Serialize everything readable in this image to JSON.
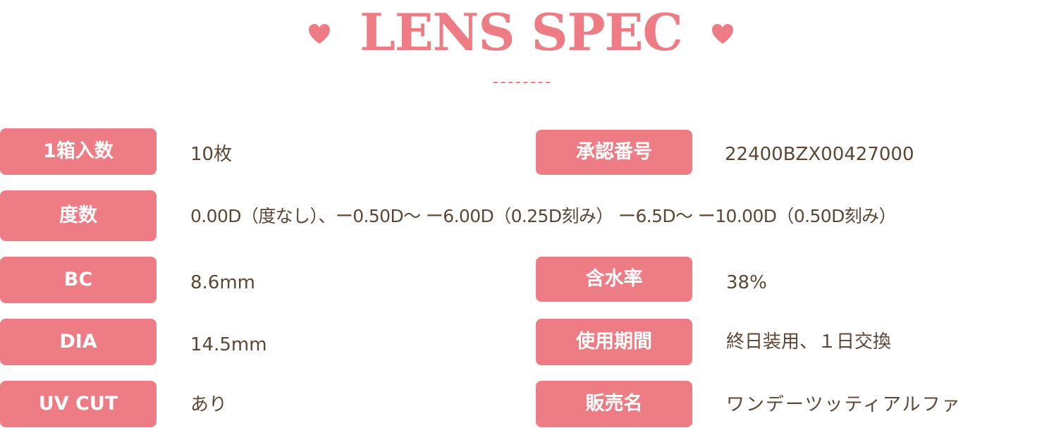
{
  "header": {
    "title": "LENS SPEC"
  },
  "colors": {
    "accent": "#ee7c84",
    "text": "#5b4733",
    "background": "#ffffff"
  },
  "icons": {
    "title_left": "heart-icon",
    "title_right": "heart-icon"
  },
  "specs": {
    "count": {
      "label": "1箱入数",
      "value": "10枚"
    },
    "approval": {
      "label": "承認番号",
      "value": "22400BZX00427000"
    },
    "power": {
      "label": "度数",
      "value": "0.00D（度なし）、ー0.50D〜 ー6.00D（0.25D刻み） ー6.5D〜 ー10.00D（0.50D刻み）"
    },
    "bc": {
      "label": "BC",
      "value": "8.6mm"
    },
    "water": {
      "label": "含水率",
      "value": "38%"
    },
    "dia": {
      "label": "DIA",
      "value": "14.5mm"
    },
    "period": {
      "label": "使用期間",
      "value": "終日装用、１日交換"
    },
    "uv": {
      "label": "UV CUT",
      "value": "あり"
    },
    "sales_name": {
      "label": "販売名",
      "value": "ワンデーツッティアルファ"
    }
  }
}
